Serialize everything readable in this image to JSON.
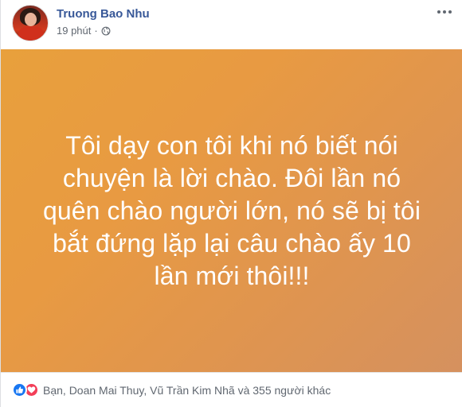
{
  "post": {
    "author": "Truong Bao Nhu",
    "time": "19 phút",
    "separator": "·",
    "privacy_icon": "globe-icon",
    "more_icon": "more-options-icon",
    "status_lines": [
      "Tôi dạy con tôi khi nó biết nói",
      "chuyện là lời chào. Đôi lần nó",
      "quên chào người lớn, nó sẽ bị tôi",
      "bắt đứng lặp lại câu chào ấy 10",
      "lần mới thôi!!!"
    ],
    "background_colors": [
      "#e8a03c",
      "#d5915f"
    ]
  },
  "footer": {
    "reaction_icons": [
      "like-icon",
      "love-icon"
    ],
    "reaction_summary": "Bạn, Doan Mai Thuy, Vũ Trần Kim Nhã và 355 người khác"
  },
  "colors": {
    "name": "#385898",
    "meta": "#606770",
    "like": "#1877f2",
    "love": "#f33e58"
  }
}
